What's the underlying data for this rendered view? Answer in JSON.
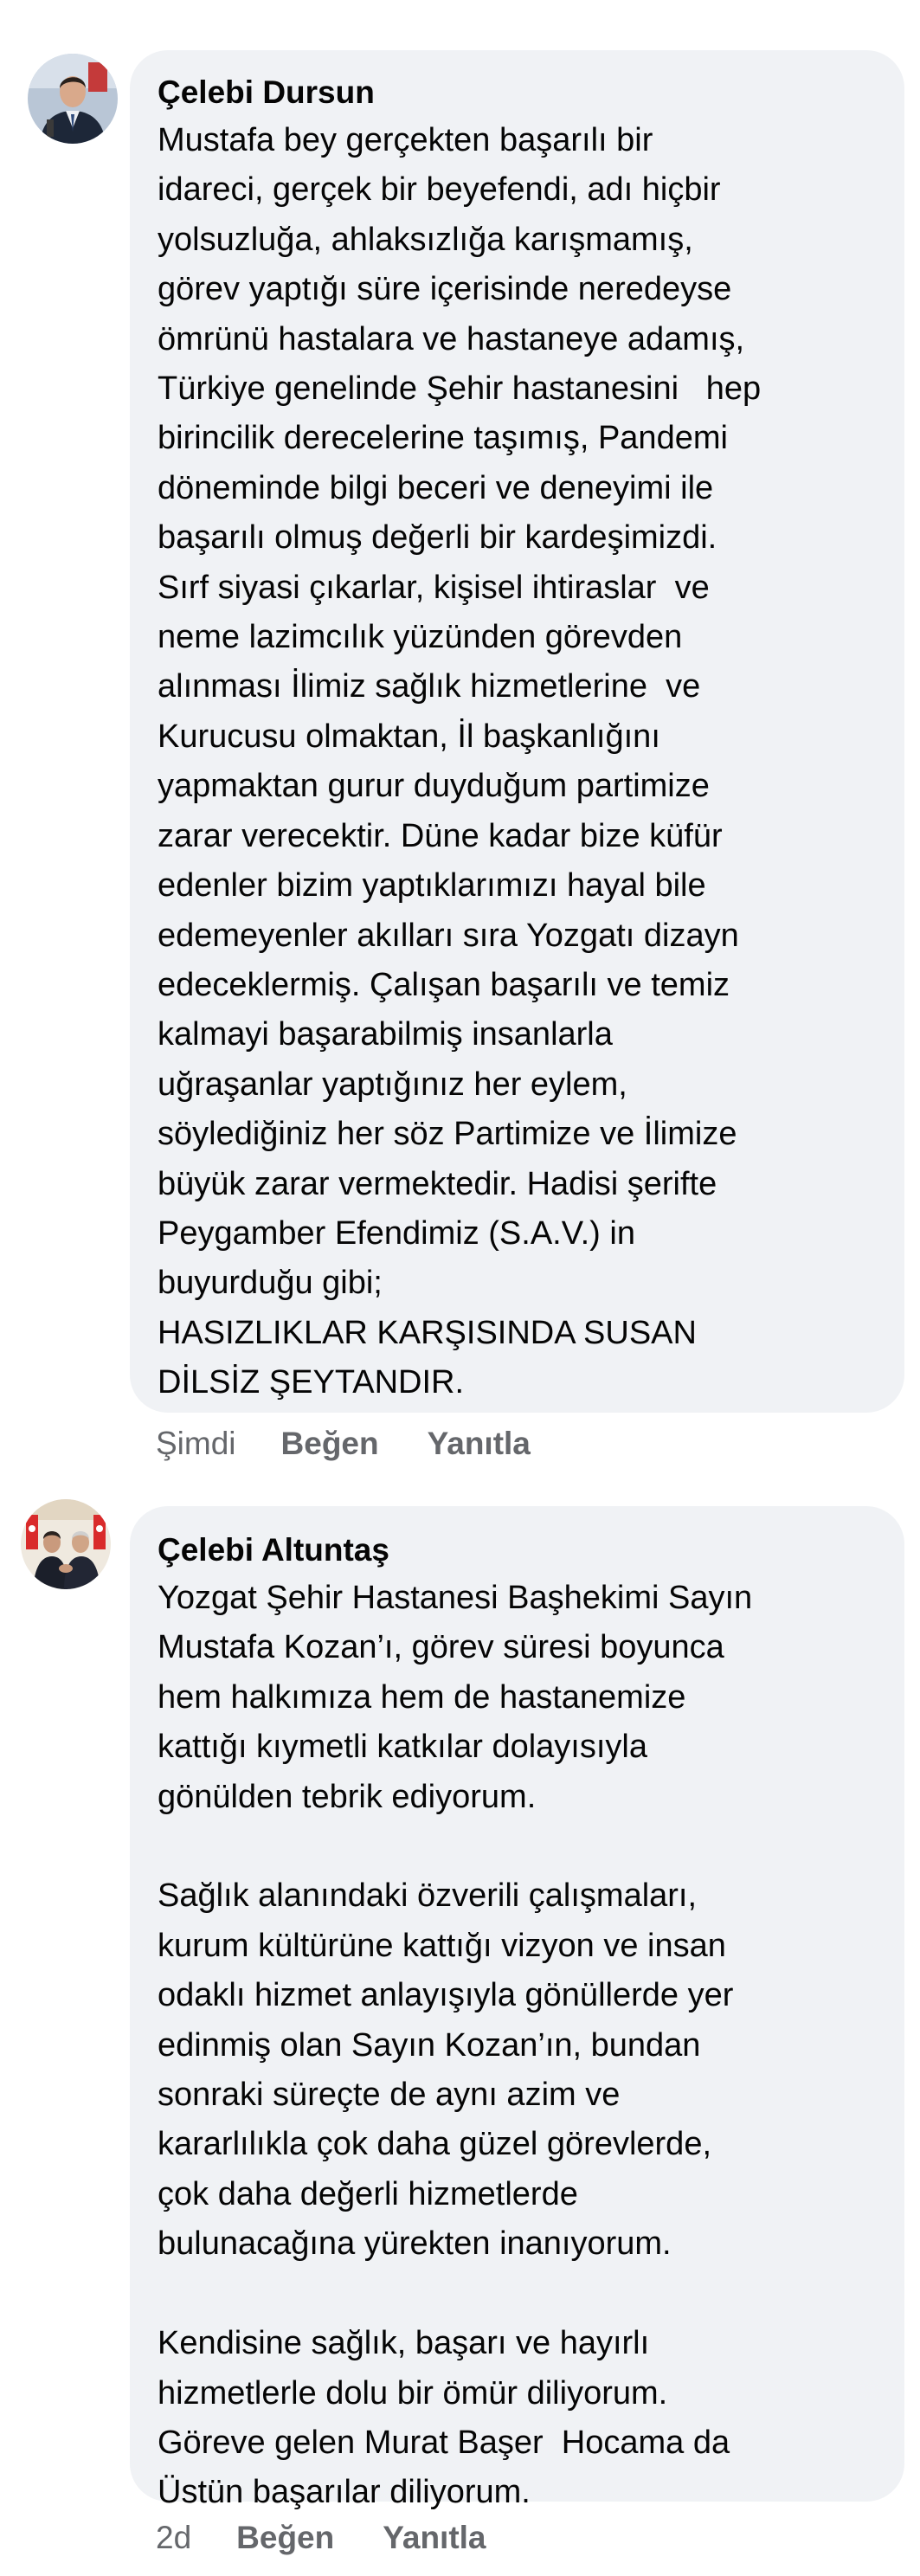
{
  "comments": [
    {
      "author": "Çelebi Dursun",
      "avatar": "avatar-man-in-suit-portrait",
      "text": "Mustafa bey gerçekten başarılı bir\nidareci, gerçek bir beyefendi, adı hiçbir\nyolsuzluğa, ahlaksızlığa karışmamış,\ngörev yaptığı süre içerisinde neredeyse\nömrünü hastalara ve hastaneye adamış,\nTürkiye genelinde Şehir hastanesini   hep\nbirincilik derecelerine taşımış, Pandemi\ndöneminde bilgi beceri ve deneyimi ile\nbaşarılı olmuş değerli bir kardeşimizdi.\nSırf siyasi çıkarlar, kişisel ihtiraslar  ve\nneme lazimcılık yüzünden görevden\nalınması İlimiz sağlık hizmetlerine  ve\nKurucusu olmaktan, İl başkanlığını\nyapmaktan gurur duyduğum partimize\nzarar verecektir. Düne kadar bize küfür\nedenler bizim yaptıklarımızı hayal bile\nedemeyenler akılları sıra Yozgatı dizayn\nedeceklermiş. Çalışan başarılı ve temiz\nkalmayi başarabilmiş insanlarla\nuğraşanlar yaptığınız her eylem,\nsöylediğiniz her söz Partimize ve İlimize\nbüyük zarar vermektedir. Hadisi şerifte\nPeygamber Efendimiz (S.A.V.) in\nbuyurduğu gibi;\nHASIZLIKLAR KARŞISINDA SUSAN\nDİLSİZ ŞEYTANDIR.",
      "time": "Şimdi",
      "like_label": "Beğen",
      "reply_label": "Yanıtla"
    },
    {
      "author": "Çelebi Altuntaş",
      "avatar": "avatar-two-men-handshake-with-flags",
      "text": "Yozgat Şehir Hastanesi Başhekimi Sayın\nMustafa Kozan’ı, görev süresi boyunca\nhem halkımıza hem de hastanemize\nkattığı kıymetli katkılar dolayısıyla\ngönülden tebrik ediyorum.\n\nSağlık alanındaki özverili çalışmaları,\nkurum kültürüne kattığı vizyon ve insan\nodaklı hizmet anlayışıyla gönüllerde yer\nedinmiş olan Sayın Kozan’ın, bundan\nsonraki süreçte de aynı azim ve\nkararlılıkla çok daha güzel görevlerde,\nçok daha değerli hizmetlerde\nbulunacağına yürekten inanıyorum.\n\nKendisine sağlık, başarı ve hayırlı\nhizmetlerle dolu bir ömür diliyorum.\nGöreve gelen Murat Başer  Hocama da\nÜstün başarılar diliyorum.",
      "time": "2d",
      "like_label": "Beğen",
      "reply_label": "Yanıtla"
    }
  ],
  "colors": {
    "bubble": "#f0f2f5",
    "text": "#050505",
    "meta": "#65676b"
  }
}
